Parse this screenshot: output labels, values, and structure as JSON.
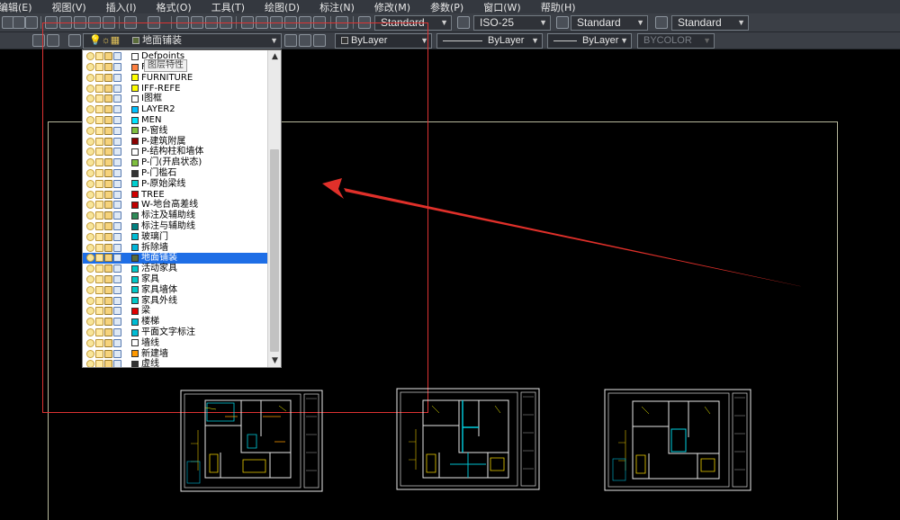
{
  "menubar": {
    "items": [
      "编辑(E)",
      "视图(V)",
      "插入(I)",
      "格式(O)",
      "工具(T)",
      "绘图(D)",
      "标注(N)",
      "修改(M)",
      "参数(P)",
      "窗口(W)",
      "帮助(H)"
    ]
  },
  "styles_toolbar": {
    "text_style": "Standard",
    "dim_style": "ISO-25",
    "table_style": "Standard",
    "multileader_style": "Standard"
  },
  "layers_toolbar": {
    "current_layer": "地面铺装",
    "current_layer_color": "#5a6b3a",
    "color": "ByLayer",
    "linetype": "ByLayer",
    "lineweight": "ByLayer",
    "plotstyle": "BYCOLOR"
  },
  "layer_dropdown": {
    "tooltip": "图层特性",
    "items": [
      {
        "name": "Defpoints",
        "color": "#ffffff"
      },
      {
        "name": "FANTFU",
        "color": "#ff8040"
      },
      {
        "name": "FURNITURE",
        "color": "#ffff00"
      },
      {
        "name": "IFF-REFE",
        "color": "#ffff00"
      },
      {
        "name": "I图框",
        "color": "#ffffff"
      },
      {
        "name": "LAYER2",
        "color": "#00c0ff"
      },
      {
        "name": "MEN",
        "color": "#00e5ff"
      },
      {
        "name": "P-窗线",
        "color": "#7fbf3f"
      },
      {
        "name": "P-建筑附属",
        "color": "#8b0000"
      },
      {
        "name": "P-结构柱和墙体",
        "color": "#ffffff"
      },
      {
        "name": "P-门(开启状态)",
        "color": "#7fbf3f"
      },
      {
        "name": "P-门槛石",
        "color": "#333333"
      },
      {
        "name": "P-原始梁线",
        "color": "#00d0d0"
      },
      {
        "name": "TREE",
        "color": "#d00000"
      },
      {
        "name": "W-地台高差线",
        "color": "#c00000"
      },
      {
        "name": "标注及辅助线",
        "color": "#2e8b57"
      },
      {
        "name": "标注与辅助线",
        "color": "#008080"
      },
      {
        "name": "玻璃门",
        "color": "#00bcd4"
      },
      {
        "name": "拆除墙",
        "color": "#00b4d8"
      },
      {
        "name": "地面铺装",
        "color": "#5a6b3a",
        "selected": true
      },
      {
        "name": "活动家具",
        "color": "#00c8c8"
      },
      {
        "name": "家具",
        "color": "#00c8c8"
      },
      {
        "name": "家具墙体",
        "color": "#00c8c8"
      },
      {
        "name": "家具外线",
        "color": "#00c8c8"
      },
      {
        "name": "梁",
        "color": "#e00000"
      },
      {
        "name": "楼梯",
        "color": "#00bcd4"
      },
      {
        "name": "平面文字标注",
        "color": "#00bcd4"
      },
      {
        "name": "墙线",
        "color": "#ffffff"
      },
      {
        "name": "新建墙",
        "color": "#ff9900"
      },
      {
        "name": "虚线",
        "color": "#333333"
      }
    ]
  },
  "colors": {
    "background": "#000000",
    "toolbar": "#3b3f46",
    "selection": "#1e6ee6",
    "annotation_arrow": "#e0302a"
  }
}
